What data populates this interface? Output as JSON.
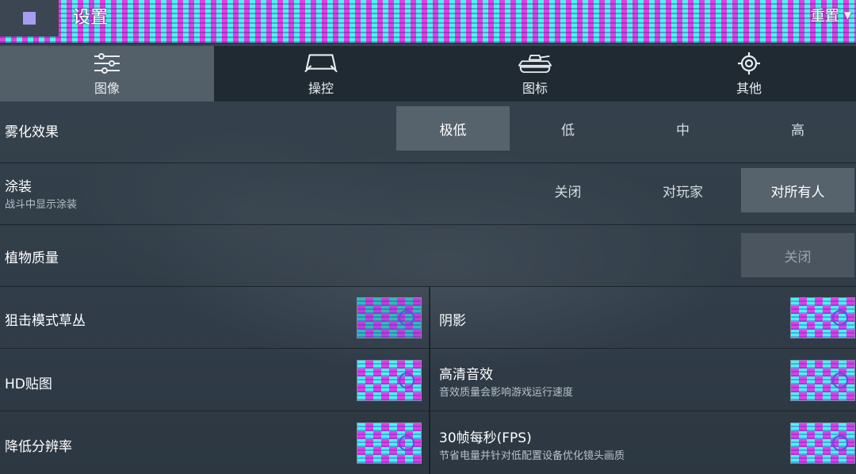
{
  "header": {
    "title": "设置",
    "reset_label": "重置"
  },
  "tabs": [
    {
      "label": "图像",
      "icon": "sliders-icon",
      "active": true
    },
    {
      "label": "操控",
      "icon": "controller-icon",
      "active": false
    },
    {
      "label": "图标",
      "icon": "tank-icon",
      "active": false
    },
    {
      "label": "其他",
      "icon": "gear-icon",
      "active": false
    }
  ],
  "settings": {
    "fog": {
      "title": "雾化效果",
      "options": [
        "极低",
        "低",
        "中",
        "高"
      ],
      "selected": "极低"
    },
    "camo": {
      "title": "涂装",
      "subtitle": "战斗中显示涂装",
      "options": [
        "关闭",
        "对玩家",
        "对所有人"
      ],
      "selected": "对所有人"
    },
    "vegetation": {
      "title": "植物质量",
      "options": [
        "关闭"
      ],
      "selected": "关闭"
    }
  },
  "toggles": {
    "sniper_grass": {
      "title": "狙击模式草丛"
    },
    "shadows": {
      "title": "阴影"
    },
    "hd_textures": {
      "title": "HD贴图"
    },
    "hd_audio": {
      "title": "高清音效",
      "subtitle": "音效质量会影响游戏运行速度"
    },
    "lower_resolution": {
      "title": "降低分辨率"
    },
    "fps30": {
      "title": "30帧每秒(FPS)",
      "subtitle": "节省电量并针对低配置设备优化镜头画质"
    }
  },
  "colors": {
    "accent_magenta": "#e23ee6",
    "accent_cyan": "#4df3ef",
    "panel": "#33404c",
    "selected": "#56626c"
  }
}
